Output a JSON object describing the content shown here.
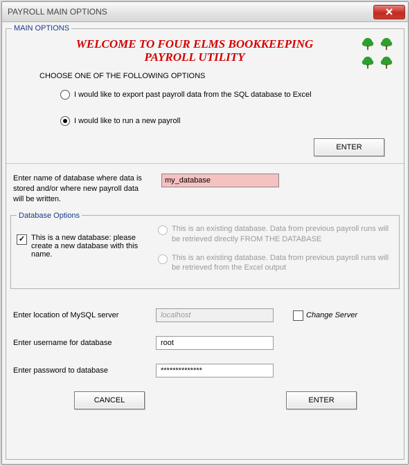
{
  "window": {
    "title": "PAYROLL MAIN OPTIONS",
    "close_glyph": "X"
  },
  "main": {
    "legend": "MAIN OPTIONS",
    "welcome_line1": "WELCOME TO FOUR ELMS BOOKKEEPING",
    "welcome_line2": "PAYROLL UTILITY",
    "choose_label": "CHOOSE ONE OF THE FOLLOWING OPTIONS",
    "option_export": "I would like to export past payroll data from the SQL database to Excel",
    "option_run": "I would like to run a new payroll",
    "enter_label": "ENTER"
  },
  "db": {
    "name_prompt": "Enter name of database where data is stored and/or where new payroll data will be written.",
    "name_value": "my_database",
    "options_legend": "Database Options",
    "new_db_label": "This is a new database: please create a new database with this name.",
    "existing_from_db": "This is an existing database. Data from  previous payroll runs will be retrieved directly FROM THE DATABASE",
    "existing_from_excel": "This is an existing database.  Data from previous payroll runs will be retrieved from the Excel output"
  },
  "server": {
    "location_label": "Enter location of MySQL server",
    "location_value": "localhost",
    "change_server_label": "Change Server",
    "username_label": "Enter username for database",
    "username_value": "root",
    "password_label": "Enter password to database",
    "password_value": "**************"
  },
  "buttons": {
    "cancel": "CANCEL",
    "enter": "ENTER"
  },
  "icons": {
    "tree": "tree-icon"
  }
}
